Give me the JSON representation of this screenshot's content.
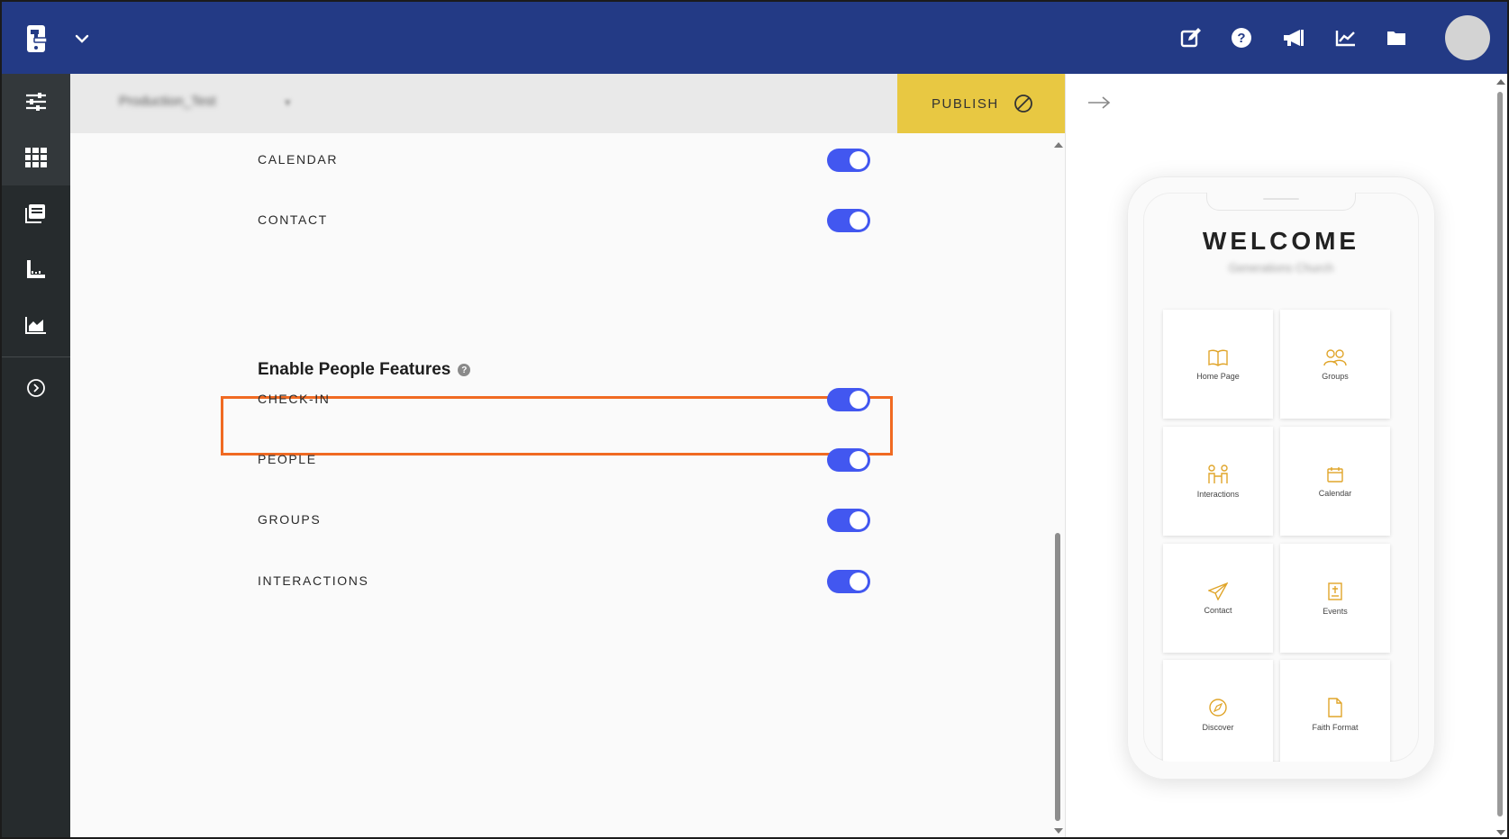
{
  "header": {
    "icons": [
      "edit-icon",
      "help-icon",
      "announcement-icon",
      "analytics-icon",
      "folder-icon"
    ]
  },
  "sidebar": {
    "items": [
      "settings-sliders-icon",
      "grid-icon",
      "pages-icon",
      "design-tools-icon",
      "analytics-chart-icon",
      "expand-icon"
    ]
  },
  "subbar": {
    "app_name": "Production_Test",
    "publish_label": "PUBLISH"
  },
  "features": {
    "top_rows": [
      {
        "label": "CALENDAR",
        "enabled": true
      },
      {
        "label": "CONTACT",
        "enabled": true
      }
    ],
    "people_section": {
      "title": "Enable People Features",
      "help": "?",
      "rows": [
        {
          "label": "CHECK-IN",
          "enabled": true
        },
        {
          "label": "PEOPLE",
          "enabled": true
        },
        {
          "label": "GROUPS",
          "enabled": true
        },
        {
          "label": "INTERACTIONS",
          "enabled": true
        }
      ]
    }
  },
  "preview": {
    "welcome": "WELCOME",
    "church_name": "Generations Church",
    "tiles": [
      {
        "label": "Home Page",
        "icon": "book-icon"
      },
      {
        "label": "Groups",
        "icon": "people-icon"
      },
      {
        "label": "Interactions",
        "icon": "interactions-icon"
      },
      {
        "label": "Calendar",
        "icon": "calendar-icon"
      },
      {
        "label": "Contact",
        "icon": "paper-plane-icon"
      },
      {
        "label": "Events",
        "icon": "events-icon"
      },
      {
        "label": "Discover",
        "icon": "compass-icon"
      },
      {
        "label": "Faith Format",
        "icon": "document-icon"
      }
    ]
  },
  "colors": {
    "header": "#233a85",
    "sidebar": "#262b2d",
    "publish": "#e8c842",
    "toggle_on": "#4257f0",
    "highlight": "#f06a22",
    "tile_icon": "#e0a52a"
  }
}
